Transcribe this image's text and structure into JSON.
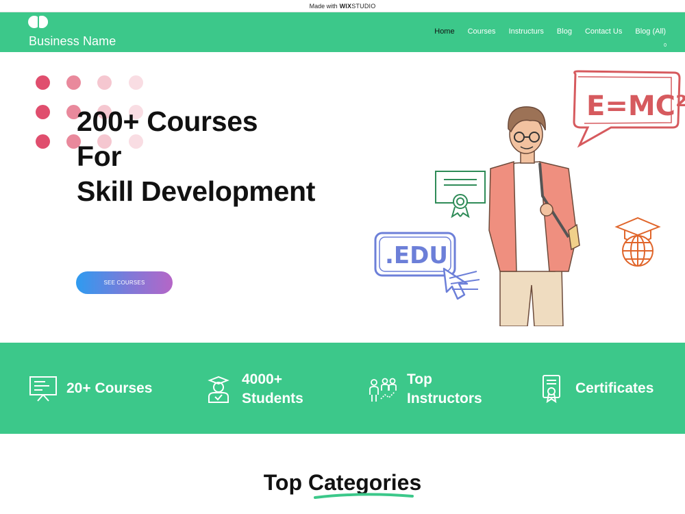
{
  "wix_banner": {
    "prefix": "Made with",
    "brand_bold": "WIX",
    "brand_rest": "STUDIO"
  },
  "header": {
    "business_name": "Business Name",
    "nav": [
      "Home",
      "Courses",
      "Instructurs",
      "Blog",
      "Contact Us",
      "Blog (All)"
    ],
    "cart_count": "0"
  },
  "hero": {
    "title_lines": [
      "200+ Courses",
      "For",
      "Skill Development"
    ],
    "cta_label": "SEE COURSES",
    "speech_text": "E=MC²",
    "edu_text": ".EDU"
  },
  "stats": [
    {
      "lines": [
        "20+ Courses"
      ],
      "icon": "presentation-board-icon"
    },
    {
      "lines": [
        "4000+",
        "Students"
      ],
      "icon": "graduate-student-icon"
    },
    {
      "lines": [
        "Top",
        "Instructors"
      ],
      "icon": "instructors-group-icon"
    },
    {
      "lines": [
        "Certificates"
      ],
      "icon": "certificate-icon"
    }
  ],
  "categories": {
    "title": "Top Categories"
  },
  "colors": {
    "brand_green": "#3cc88a",
    "dot_dark": "#e04e6e",
    "dot_mid": "#e9899c",
    "dot_light": "#f5c7d0",
    "dot_faint": "#f9dde3"
  }
}
